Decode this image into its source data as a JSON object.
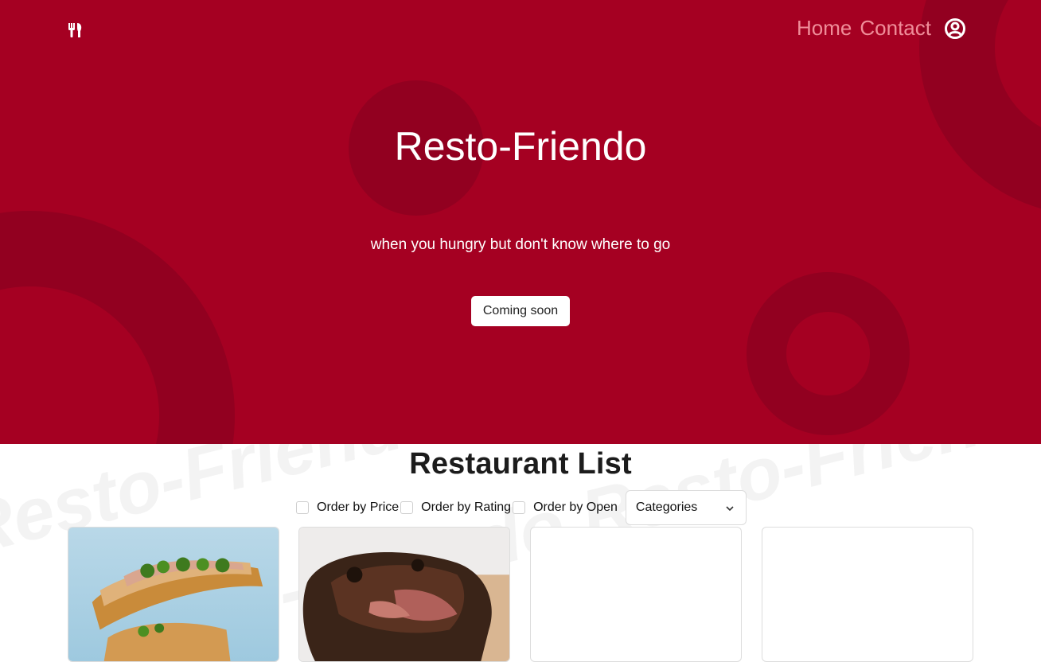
{
  "nav": {
    "logo_icon": "utensils-icon",
    "links": [
      "Home",
      "Contact"
    ],
    "user_icon": "user-circle-icon"
  },
  "hero": {
    "title": "Resto-Friendo",
    "subtitle": "when you hungry but don't know where to go",
    "button": "Coming soon",
    "colors": {
      "background": "#a50022",
      "accent_shape": "#920020",
      "nav_link": "#ef8d99"
    }
  },
  "list": {
    "title": "Restaurant List",
    "filters": [
      "Order by Price",
      "Order by Rating",
      "Order by Open"
    ],
    "select_value": "Categories",
    "select_icon": "chevron-down-icon",
    "watermark": "Resto-Friendo Resto-Friendo Resto-Friendo",
    "cards": [
      {
        "image": "sandwich-photo"
      },
      {
        "image": "roast-meat-photo"
      },
      {
        "image": ""
      },
      {
        "image": ""
      }
    ]
  }
}
